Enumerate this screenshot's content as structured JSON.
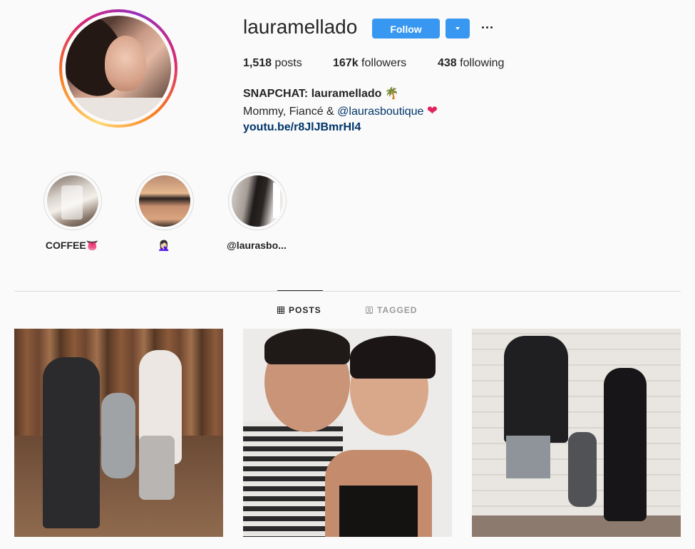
{
  "profile": {
    "username": "lauramellado",
    "follow_label": "Follow",
    "stats": {
      "posts_count": "1,518",
      "posts_label": "posts",
      "followers_count": "167k",
      "followers_label": "followers",
      "following_count": "438",
      "following_label": "following"
    },
    "bio": {
      "name": "SNAPCHAT: lauramellado",
      "name_emoji": "🌴",
      "line_prefix": "Mommy, Fiancé & ",
      "mention": "@laurasboutique",
      "line_emoji": "❤",
      "link": "youtu.be/r8JlJBmrHl4"
    }
  },
  "highlights": [
    {
      "label": "COFFEE👅"
    },
    {
      "label": "🤦🏻‍♀️"
    },
    {
      "label": "@laurasbo..."
    }
  ],
  "tabs": {
    "posts": "POSTS",
    "tagged": "TAGGED"
  },
  "colors": {
    "accent": "#3897f0",
    "link": "#003569",
    "text": "#262626",
    "border": "#dbdbdb",
    "background": "#fafafa"
  },
  "icons": [
    "more-options-icon",
    "chevron-down-icon",
    "grid-icon",
    "tagged-icon"
  ]
}
